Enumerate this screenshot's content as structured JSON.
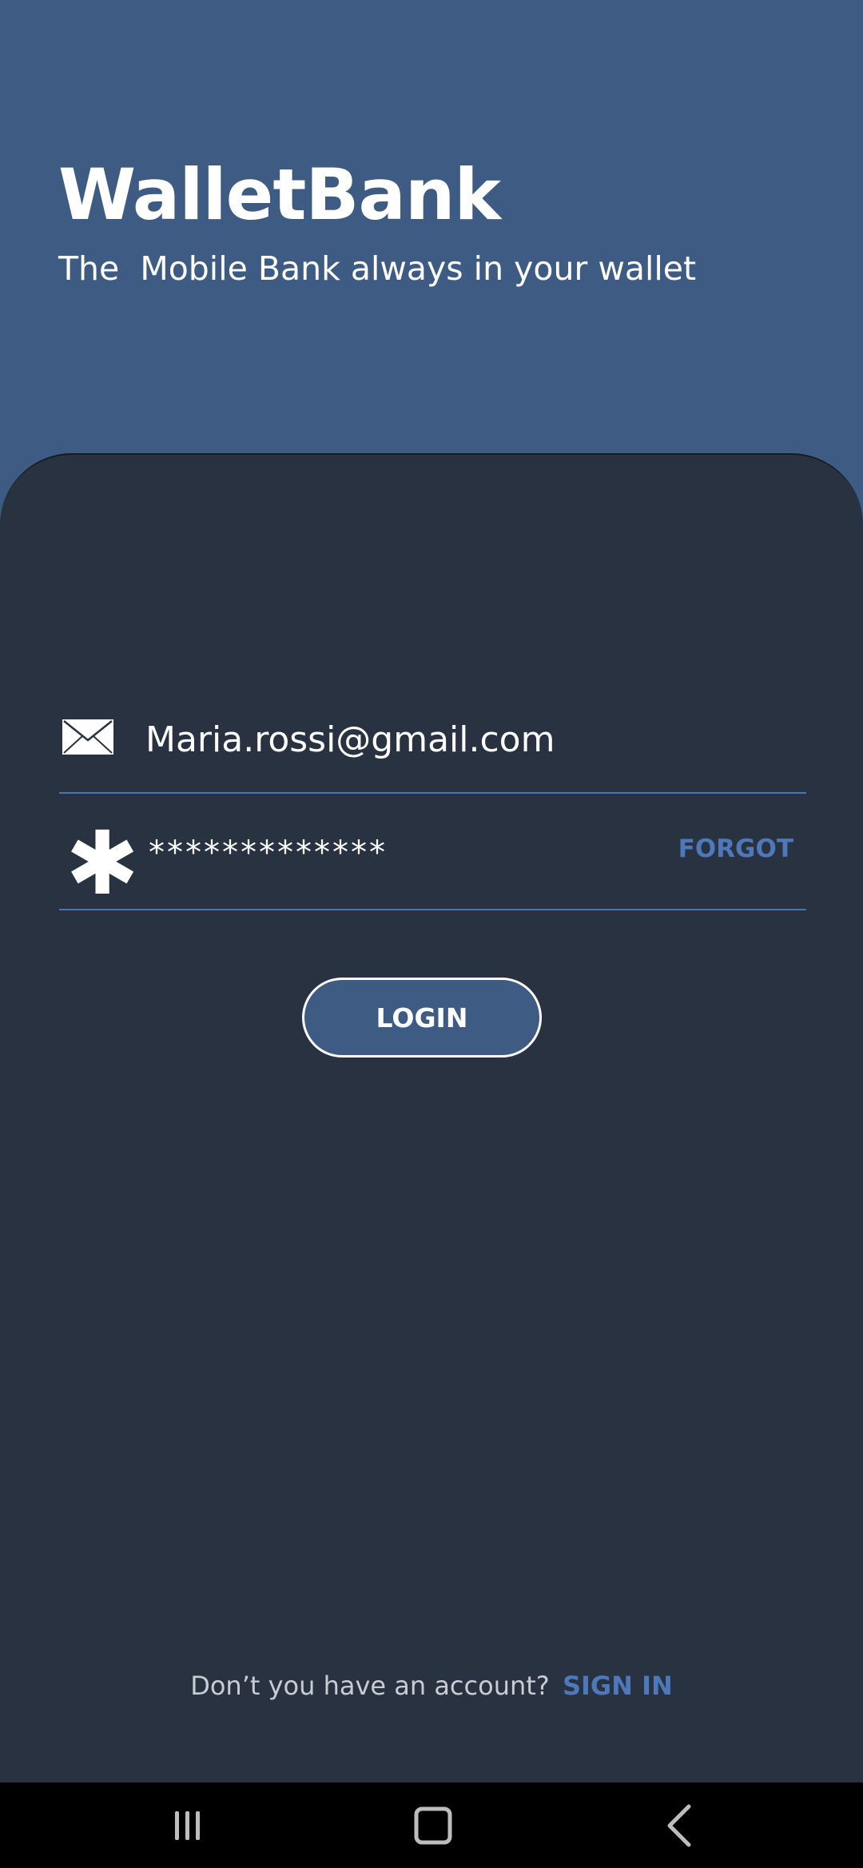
{
  "header": {
    "title": "WalletBank",
    "subtitle": "The  Mobile Bank always in your wallet"
  },
  "login_form": {
    "email": {
      "icon": "mail-icon",
      "value": "Maria.rossi@gmail.com"
    },
    "password": {
      "icon": "asterisk-icon",
      "value": "*************",
      "forgot_label": "FORGOT"
    },
    "login_button_label": "LOGIN"
  },
  "footer": {
    "prompt": "Don’t you have an account?",
    "signin_label": "SIGN IN"
  },
  "nav_bar": {
    "recent_icon": "recent-apps-icon",
    "home_icon": "home-icon",
    "back_icon": "back-icon"
  },
  "colors": {
    "header_bg": "#3e5c83",
    "card_bg": "#293241",
    "accent": "#4d79bb",
    "divider": "#4a74b8"
  }
}
